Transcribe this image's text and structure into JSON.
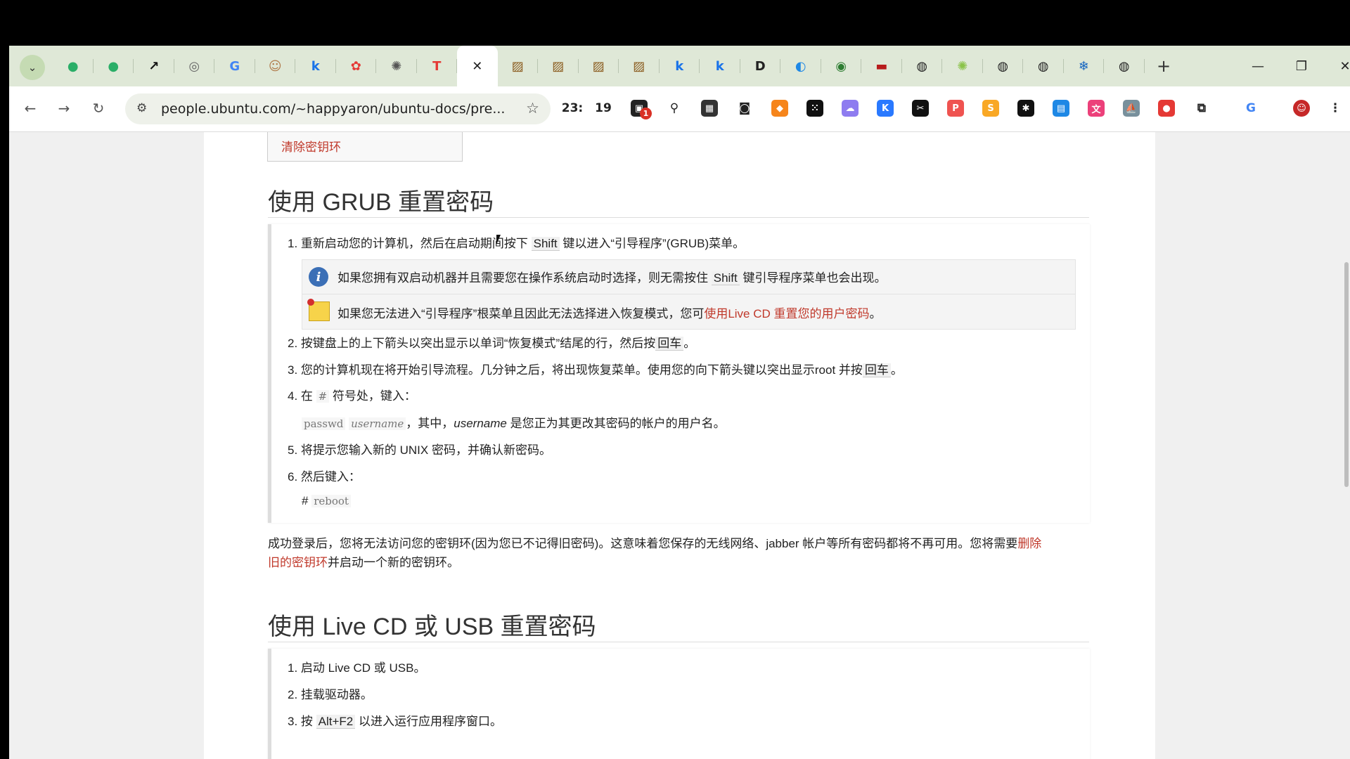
{
  "tabs": {
    "group_icon": "chevron-down-icon",
    "items": [
      {
        "name": "wechat-tab",
        "glyph": "●",
        "color": "#2aae67"
      },
      {
        "name": "wechat-tab-2",
        "glyph": "●",
        "color": "#2aae67"
      },
      {
        "name": "arrow-tab",
        "glyph": "↗",
        "color": "#111"
      },
      {
        "name": "globe-tab",
        "glyph": "◎",
        "color": "#666"
      },
      {
        "name": "google-tab",
        "glyph": "G",
        "color": "#4285f4"
      },
      {
        "name": "avatar-tab",
        "glyph": "☺",
        "color": "#b07a4a"
      },
      {
        "name": "k-tab",
        "glyph": "k",
        "color": "#1a73e8"
      },
      {
        "name": "huawei-tab",
        "glyph": "✿",
        "color": "#e53935"
      },
      {
        "name": "openai-tab",
        "glyph": "✺",
        "color": "#555"
      },
      {
        "name": "red-t-tab",
        "glyph": "T",
        "color": "#e53935"
      },
      {
        "name": "active-tab",
        "glyph": "✕",
        "color": "#222"
      },
      {
        "name": "image-tab-1",
        "glyph": "▨",
        "color": "#8a5a1c"
      },
      {
        "name": "image-tab-2",
        "glyph": "▨",
        "color": "#8a5a1c"
      },
      {
        "name": "image-tab-3",
        "glyph": "▨",
        "color": "#8a5a1c"
      },
      {
        "name": "image-tab-4",
        "glyph": "▨",
        "color": "#8a5a1c"
      },
      {
        "name": "k-tab-2",
        "glyph": "k",
        "color": "#1a73e8"
      },
      {
        "name": "k-tab-3",
        "glyph": "k",
        "color": "#1a73e8"
      },
      {
        "name": "dash-tab",
        "glyph": "D",
        "color": "#222"
      },
      {
        "name": "edge-tab",
        "glyph": "◐",
        "color": "#1e88e5"
      },
      {
        "name": "green-tab",
        "glyph": "◉",
        "color": "#2e7d32"
      },
      {
        "name": "card-tab",
        "glyph": "▬",
        "color": "#b71c1c"
      },
      {
        "name": "github-tab-1",
        "glyph": "◍",
        "color": "#222"
      },
      {
        "name": "chatgpt-tab",
        "glyph": "✺",
        "color": "#8bc34a"
      },
      {
        "name": "github-tab-2",
        "glyph": "◍",
        "color": "#222"
      },
      {
        "name": "github-tab-3",
        "glyph": "◍",
        "color": "#222"
      },
      {
        "name": "snowflake-tab",
        "glyph": "❄",
        "color": "#1565c0"
      },
      {
        "name": "github-tab-4",
        "glyph": "◍",
        "color": "#222"
      }
    ],
    "new_tab": "+",
    "minimize": "—",
    "restore": "❐",
    "close": "✕"
  },
  "toolbar": {
    "back": "←",
    "forward": "→",
    "reload": "↻",
    "url": "people.ubuntu.com/~happyaron/ubuntu-docs/pre...",
    "site_info": "⚙",
    "star": "☆",
    "counter_a": "23:",
    "counter_b": "19",
    "badge": "1"
  },
  "content": {
    "clear_keyring": "清除密钥环",
    "h_grub": "使用 GRUB 重置密码",
    "s1_pre": "1. 重新启动您的计算机，然后在启动期间按下 ",
    "s1_key": "Shift",
    "s1_post": " 键以进入“引导程序”(GRUB)菜单。",
    "note1_pre": "如果您拥有双启动机器并且需要您在操作系统启动时选择，则无需按住 ",
    "note1_key": "Shift",
    "note1_post": " 键引导程序菜单也会出现。",
    "note2_pre": "如果您无法进入“引导程序”根菜单且因此无法选择进入恢复模式，您可",
    "note2_link": "使用Live CD 重置您的用户密码",
    "note2_post": "。",
    "s2_pre": "2. 按键盘上的上下箭头以突出显示以单词“恢复模式”结尾的行，然后按",
    "s2_key": "回车",
    "s2_post": "。",
    "s3_pre": "3. 您的计算机现在将开始引导流程。几分钟之后，将出现恢复菜单。使用您的向下箭头键以突出显示root 并按",
    "s3_key": "回车",
    "s3_post": "。",
    "s4_pre": "4. 在 ",
    "s4_code": "#",
    "s4_post": " 符号处，键入：",
    "cmd_passwd": "passwd",
    "cmd_user": "username",
    "cmd_desc_a": "，其中，",
    "cmd_desc_user": "username",
    "cmd_desc_b": " 是您正为其更改其密码的帐户的用户名。",
    "s5": "5. 将提示您输入新的 UNIX 密码，并确认新密码。",
    "s6": "6. 然后键入：",
    "reboot_hash": "#",
    "reboot_cmd": "reboot",
    "para_pre": "成功登录后，您将无法访问您的密钥环(因为您已不记得旧密码)。这意味着您保存的无线网络、jabber 帐户等所有密码都将不再可用。您将需要",
    "para_link1": "删除",
    "para_link2": "旧的密钥环",
    "para_post": "并启动一个新的密钥环。",
    "h_live": "使用 Live CD 或 USB 重置密码",
    "l1": "1. 启动 Live CD 或 USB。",
    "l2": "2. 挂载驱动器。",
    "l3_pre": "3. 按 ",
    "l3_key": "Alt+F2",
    "l3_post": " 以进入运行应用程序窗口。"
  }
}
